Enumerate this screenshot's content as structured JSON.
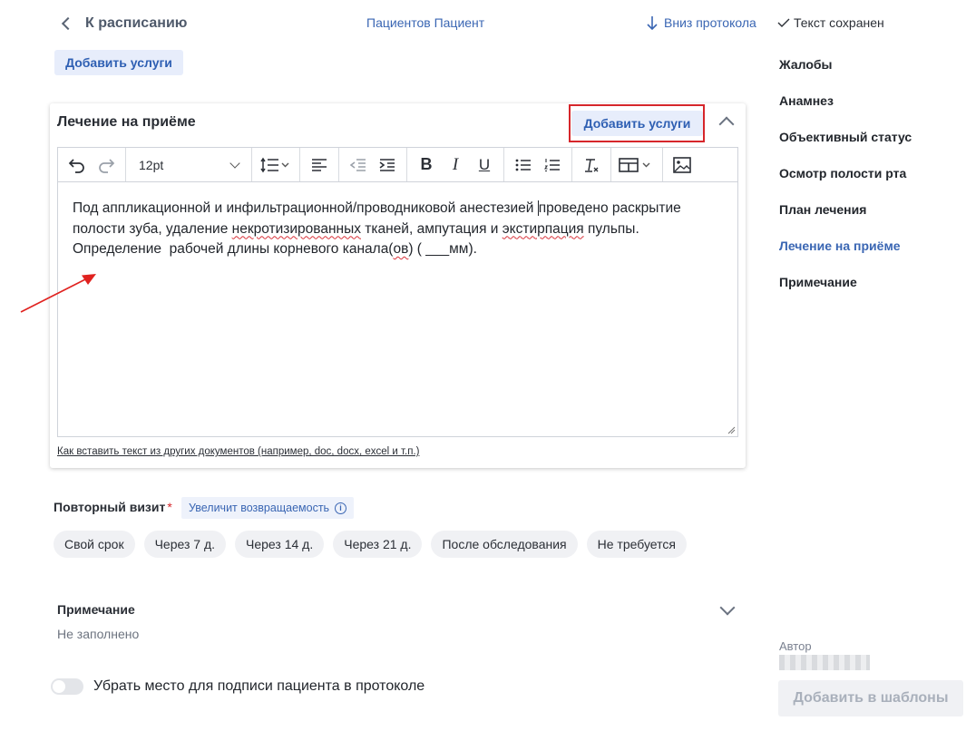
{
  "header": {
    "back_label": "К расписанию",
    "patient_name": "Пациентов Пациент",
    "down_link": "Вниз протокола",
    "saved_status": "Текст сохранен"
  },
  "add_services_label": "Добавить услуги",
  "card": {
    "title": "Лечение на приёме",
    "add_services_label": "Добавить услуги",
    "font_size": "12pt",
    "editor_text": {
      "line1_a": "Под аппликационной и инфильтрационной/проводниковой анестезией ",
      "line1_b": "проведено раскрытие",
      "line2_a": "полости зуба, удаление ",
      "line2_err1": "некротизированных",
      "line2_b": " тканей, ампутация и ",
      "line2_err2": "экстирпация",
      "line2_c": " пульпы.",
      "line3_a": "Определение  рабочей длины корневого канала(",
      "line3_err": "ов",
      "line3_b": ") ( ___мм)."
    },
    "howto_link": "Как вставить текст из других документов (например, doc, docx, excel и т.п.)"
  },
  "repeat_visit": {
    "label": "Повторный визит",
    "required_mark": "*",
    "badge": "Увеличит возвращаемость",
    "options": [
      "Свой срок",
      "Через 7 д.",
      "Через 14 д.",
      "Через 21 д.",
      "После обследования",
      "Не требуется"
    ]
  },
  "note": {
    "title": "Примечание",
    "value": "Не заполнено"
  },
  "signature_toggle": {
    "label": "Убрать место для подписи пациента в протоколе",
    "checked": false
  },
  "sidebar": {
    "items": [
      {
        "label": "Жалобы",
        "active": false
      },
      {
        "label": "Анамнез",
        "active": false
      },
      {
        "label": "Объективный статус",
        "active": false
      },
      {
        "label": "Осмотр полости рта",
        "active": false
      },
      {
        "label": "План лечения",
        "active": false
      },
      {
        "label": "Лечение на приёме",
        "active": true
      },
      {
        "label": "Примечание",
        "active": false
      }
    ],
    "author_label": "Автор",
    "add_template_label": "Добавить в шаблоны"
  },
  "colors": {
    "accent": "#3a66b3",
    "highlight_box": "#d6262b",
    "annotation_arrow": "#e0221f"
  }
}
